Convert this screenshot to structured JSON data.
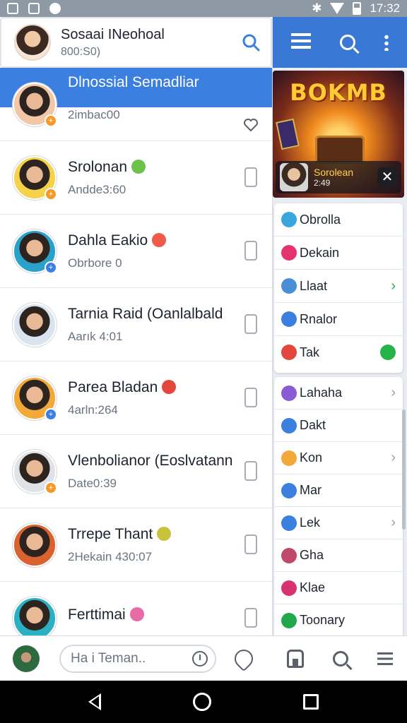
{
  "status_bar": {
    "time": "17:32"
  },
  "header": {
    "title": "Sosaai INeohoal",
    "subtitle": "800:S0)"
  },
  "chats": [
    {
      "name": "Dlnossial Semadliar",
      "sub": "2imbac00",
      "avatar_color": "#f2c7a6",
      "badge_color": "#f39a2b",
      "emoji_color": "",
      "right": "heart-outline-icon",
      "active": true
    },
    {
      "name": "Srolonan",
      "sub": "Andde3:60",
      "avatar_color": "#f4d24a",
      "badge_color": "#f39a2b",
      "emoji_color": "#6cc24a",
      "right": "phone-icon"
    },
    {
      "name": "Dahla Eakio",
      "sub": "Obrbore 0",
      "avatar_color": "#2aa1c9",
      "badge_color": "#3b7fe0",
      "emoji_color": "#f05a4a",
      "right": "phone-icon"
    },
    {
      "name": "Tarnia Raid (Oanlalbald",
      "sub": "Aarık 4:01",
      "avatar_color": "#d9e4ef",
      "badge_color": "",
      "emoji_color": "",
      "right": "phone-icon"
    },
    {
      "name": "Parea Bladan",
      "sub": "4arln:264",
      "avatar_color": "#f2a93a",
      "badge_color": "#3b7fe0",
      "emoji_color": "#e2463c",
      "right": "phone-icon"
    },
    {
      "name": "Vlenbolianor (Eoslvatann",
      "sub": "Date0:39",
      "avatar_color": "#dfe3e8",
      "badge_color": "#f39a2b",
      "emoji_color": "",
      "right": "phone-icon"
    },
    {
      "name": "Trrepe Thant",
      "sub": "2Hekain 430:07",
      "avatar_color": "#d9622f",
      "badge_color": "",
      "emoji_color": "#c9c23a",
      "right": "phone-icon"
    },
    {
      "name": "Ferttimai",
      "sub": "",
      "avatar_color": "#2ab0c2",
      "badge_color": "",
      "emoji_color": "#e86aa6",
      "right": "phone-icon"
    }
  ],
  "composer": {
    "placeholder": "Ha i Teman.."
  },
  "game": {
    "title": "BOKMB",
    "player": "Sorolean",
    "time": "2:49"
  },
  "right_card_1": [
    {
      "label": "Obrolla",
      "dot": "#3aa6e0",
      "tail": ""
    },
    {
      "label": "Dekain",
      "dot": "#e6336f",
      "tail": ""
    },
    {
      "label": "Llaat",
      "dot": "#4a8fd6",
      "tail": "›"
    },
    {
      "label": "Rnalor",
      "dot": "#3b7fe0",
      "tail": ""
    },
    {
      "label": "Tak",
      "dot": "#e2463c",
      "tail": ""
    }
  ],
  "right_card_2": [
    {
      "label": "Lahaha",
      "dot": "#8b5bd6",
      "tail": "›"
    },
    {
      "label": "Dakt",
      "dot": "#3b7fe0",
      "tail": ""
    },
    {
      "label": "Kon",
      "dot": "#f2a93a",
      "tail": "›"
    },
    {
      "label": "Mar",
      "dot": "#3b7fe0",
      "tail": ""
    },
    {
      "label": "Lek",
      "dot": "#3b7fe0",
      "tail": "›"
    },
    {
      "label": "Gha",
      "dot": "#c0486a",
      "tail": ""
    },
    {
      "label": "Klae",
      "dot": "#d6336f",
      "tail": ""
    },
    {
      "label": "Toonary",
      "dot": "#20a84b",
      "tail": ""
    }
  ],
  "colors": {
    "accent": "#3b7fe0",
    "right_header": "#3a78d6",
    "green": "#20a84b"
  }
}
